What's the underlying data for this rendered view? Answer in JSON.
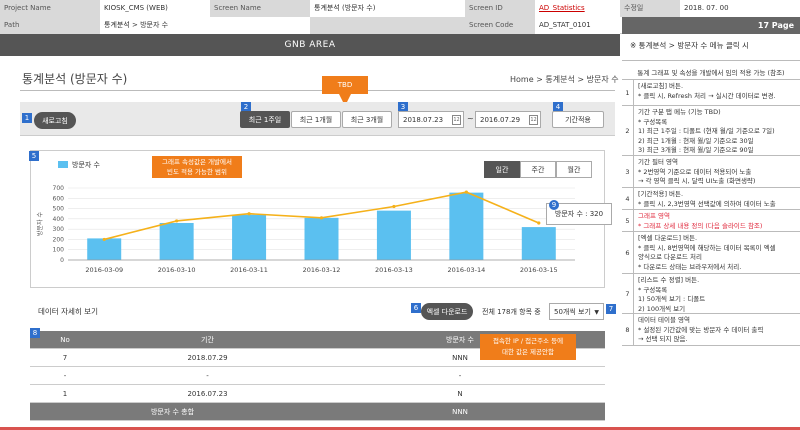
{
  "header": {
    "project_name_label": "Project Name",
    "project_name": "KIOSK_CMS (WEB)",
    "screen_name_label": "Screen Name",
    "screen_name": "통계분석 (방문자 수)",
    "screen_id_label": "Screen ID",
    "screen_id": "AD_Statistics",
    "date_label": "수정일",
    "date": "2018. 07. 00",
    "path_label": "Path",
    "path": "통계분석 > 방문자 수",
    "screen_code_label": "Screen Code",
    "screen_code": "AD_STAT_0101",
    "page_no": "17 Page"
  },
  "gnb": "GNB AREA",
  "page_title": "통계분석 (방문자 수)",
  "breadcrumb": "Home > 통계분석 > 방문자 수",
  "toolbar": {
    "refresh": "새로고침",
    "tabs": [
      "최근 1주일",
      "최근 1개월",
      "최근 3개월"
    ],
    "date_from": "2018.07.23",
    "date_sep": "~",
    "date_to": "2016.07.29",
    "apply": "기간적용",
    "cal": "12",
    "tbd": "TBD"
  },
  "badges": [
    "1",
    "2",
    "3",
    "4",
    "5",
    "6",
    "7",
    "8",
    "9"
  ],
  "chart_note": "그래프 속성값은 개발에서\n빈도 적용 가능한 범위",
  "period_buttons": [
    "일간",
    "주간",
    "월간"
  ],
  "tooltip": "방문자 수 : 320",
  "chart_data": {
    "type": "bar",
    "legend": "방문자 수",
    "ylabel": "방문자 수",
    "categories": [
      "2016-03-09",
      "2016-03-10",
      "2016-03-11",
      "2016-03-12",
      "2016-03-13",
      "2016-03-14",
      "2016-03-15"
    ],
    "bar_values": [
      210,
      360,
      440,
      410,
      480,
      655,
      320
    ],
    "line_values": [
      200,
      380,
      450,
      410,
      520,
      660,
      360
    ],
    "yticks": [
      0,
      100,
      200,
      300,
      400,
      500,
      600,
      700
    ],
    "ylim": [
      0,
      700
    ],
    "bar_color": "#5bc0f0",
    "line_color": "#f5b11a"
  },
  "detail": {
    "title": "데이터 자세히 보기",
    "excel": "엑셀 다운로드",
    "total": "전체 178개 항목 중",
    "page_size": "50개씩 보기",
    "note": "접속한 IP / 접근주소 등에\n대한 값은 제공안함"
  },
  "table": {
    "headers": [
      "No",
      "기간",
      "방문자 수"
    ],
    "rows": [
      [
        "7",
        "2018.07.29",
        "NNN"
      ],
      [
        "-",
        "-",
        "-"
      ],
      [
        "1",
        "2016.07.23",
        "N"
      ]
    ],
    "footer_label": "방문자 수 총합",
    "footer_value": "NNN"
  },
  "right": {
    "title": "※ 통계분석 > 방문자 수 메뉴 클릭 시",
    "desc": "통계 그래프 및 속성을 개발에서 임의 적용 가능 (참조)",
    "items": [
      {
        "n": "1",
        "text": "[새로고침] 버튼.\n* 클릭 시, Refresh 처리 → 실시간 데이터로 변경."
      },
      {
        "n": "2",
        "text": "기간 구분 탭 메뉴 (기능 TBD)\n* 구성목록\n1) 최근 1주일 : 디폴트 (현재 월/일 기준으로 7일)\n2) 최근 1개월 : 현재 월/일 기준으로 30일\n3) 최근 3개월 : 현재 월/일 기준으로 90일"
      },
      {
        "n": "3",
        "text": "기간 필터 영역\n* 2번영역 기준으로 데이터 적용되어 노출\n→ 각 영역 클릭 시, 달력 UI노출 (화면생략)"
      },
      {
        "n": "4",
        "text": "[기간적용] 버튼.\n* 클릭 시, 2,3번영역 선택값에 의하여 데이터 노출"
      },
      {
        "n": "5",
        "text": "그래프 영역\n* 그래프 상세 내용 정의 (다음 슬라이드 참조)"
      },
      {
        "n": "6",
        "text": "[엑셀 다운로드] 버튼.\n* 클릭 시, 8번영역에 해당하는 데이터 목록이 엑셀\n양식으로 다운로드 처리\n* 다운로드 상태는 브라우저에서 처리."
      },
      {
        "n": "7",
        "text": "[리스트 수 정렬] 버튼.\n* 구성목록\n1) 50개씩 보기 : 디폴트\n2) 100개씩 보기"
      },
      {
        "n": "8",
        "text": "데이터 테이블 영역\n* 설정된 기간값에 맞는 방문자 수 데이터 출력\n→ 선택 되지 않음."
      }
    ]
  }
}
